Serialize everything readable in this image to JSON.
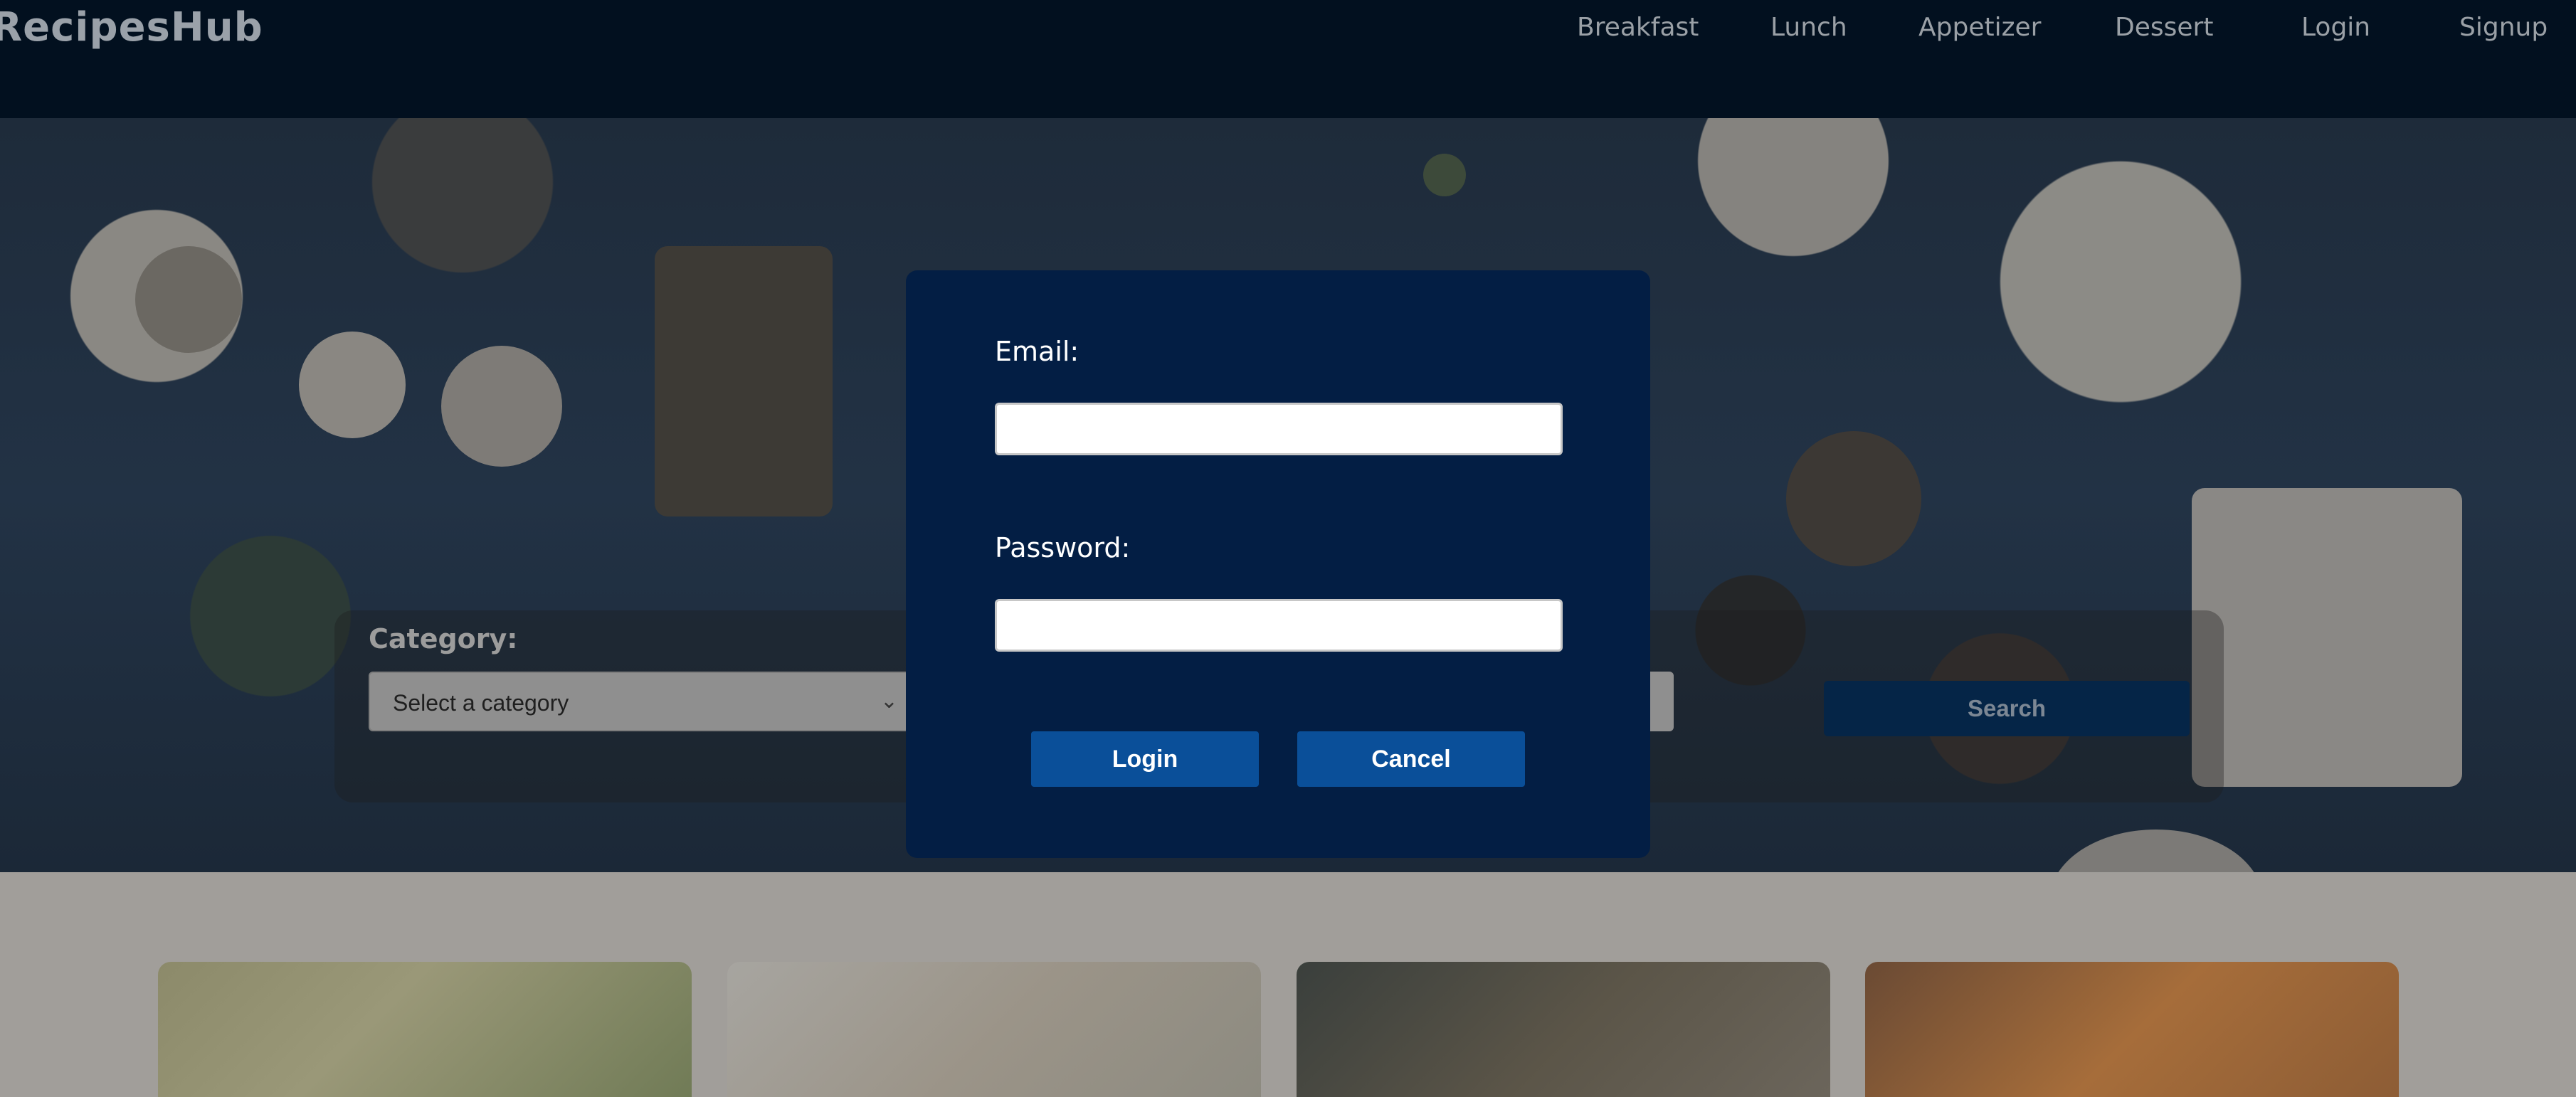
{
  "navbar": {
    "brand": "RecipesHub",
    "items": [
      "Breakfast",
      "Lunch",
      "Appetizer",
      "Dessert",
      "Login",
      "Signup"
    ]
  },
  "search": {
    "category_label": "Category:",
    "category_selected": "Select a category",
    "search_button": "Search"
  },
  "modal": {
    "email_label": "Email:",
    "email_value": "",
    "password_label": "Password:",
    "password_value": "",
    "login_button": "Login",
    "cancel_button": "Cancel"
  },
  "colors": {
    "navbar_bg": "#02101f",
    "modal_bg": "#031e44",
    "button_bg": "#0a4f99",
    "search_button_bg": "#052547"
  }
}
